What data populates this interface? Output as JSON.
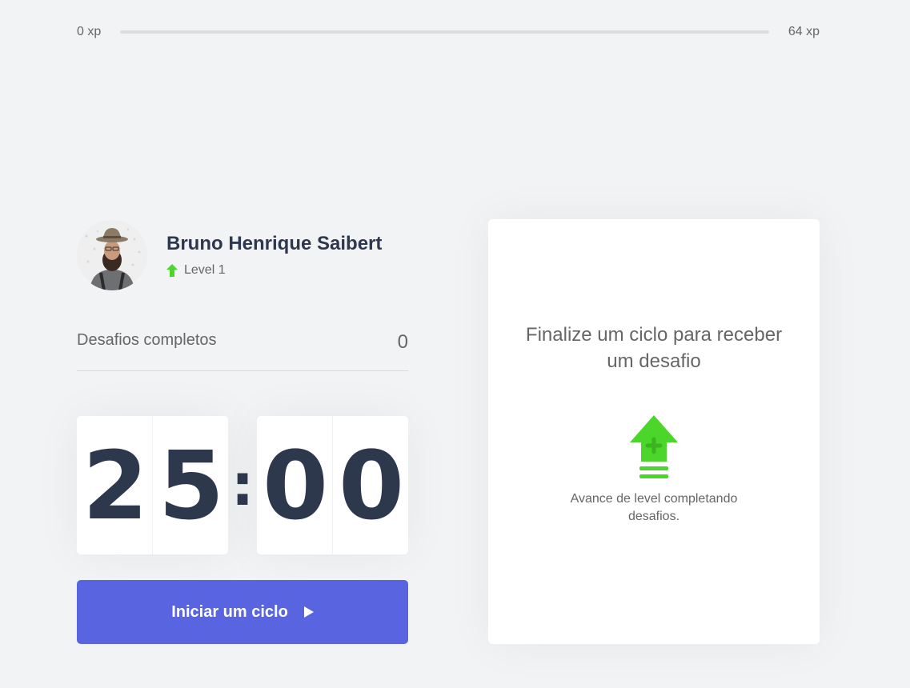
{
  "xp": {
    "current_label": "0 xp",
    "next_label": "64 xp",
    "progress_fraction": 0
  },
  "profile": {
    "name": "Bruno Henrique Saibert",
    "level": "Level 1"
  },
  "completed_challenges": {
    "label": "Desafios completos",
    "count": "0"
  },
  "countdown": {
    "minute_left": "2",
    "minute_right": "5",
    "separator": ":",
    "second_left": "0",
    "second_right": "0"
  },
  "start_button": {
    "label": "Iniciar um ciclo",
    "icon": "play-icon"
  },
  "challenge_card": {
    "title": "Finalize um ciclo para receber um desafio",
    "icon": "level-up-icon",
    "description": "Avance de level completando desafios."
  },
  "colors": {
    "background": "#f2f3f5",
    "primary": "#5965e0",
    "green": "#4cd62b",
    "title": "#2e384d",
    "text": "#666666"
  }
}
